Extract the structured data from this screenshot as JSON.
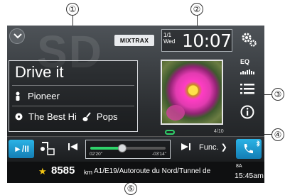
{
  "callouts": [
    "①",
    "②",
    "③",
    "④",
    "⑤"
  ],
  "header": {
    "mixtrax_label": "MIXTRAX",
    "date_line1": "1/1",
    "weekday": "Wed",
    "time": "10:07"
  },
  "now_playing": {
    "title": "Drive it",
    "artist": "Pioneer",
    "album": "The Best Hi",
    "genre": "Pops"
  },
  "side_menu": {
    "eq_label": "EQ"
  },
  "track_counter": "4/10",
  "controls": {
    "play_pause_label": "►/II",
    "func_label": "Func.",
    "elapsed": "02'20\"",
    "remaining": "-03'14\"",
    "progress_fraction": 0.42
  },
  "nav": {
    "distance": "8585",
    "distance_unit": "km",
    "route": "A1/E19/Autoroute du Nord/Tunnel de",
    "clock": "15:45am",
    "badge": "8A"
  },
  "colors": {
    "accent_blue": "#1e9bd4",
    "progress_green": "#2fd36a",
    "star_yellow": "#f4c613"
  },
  "icons": {
    "menu": "chevron-down-icon",
    "settings": "gears-icon",
    "list": "list-icon",
    "info": "info-icon",
    "phone": "phone-icon",
    "bluetooth": "bluetooth-icon",
    "repeat": "repeat-icon",
    "source": "music-source-icon",
    "artist": "person-icon",
    "album": "disc-icon",
    "genre": "guitar-icon",
    "favorite": "star-icon"
  }
}
